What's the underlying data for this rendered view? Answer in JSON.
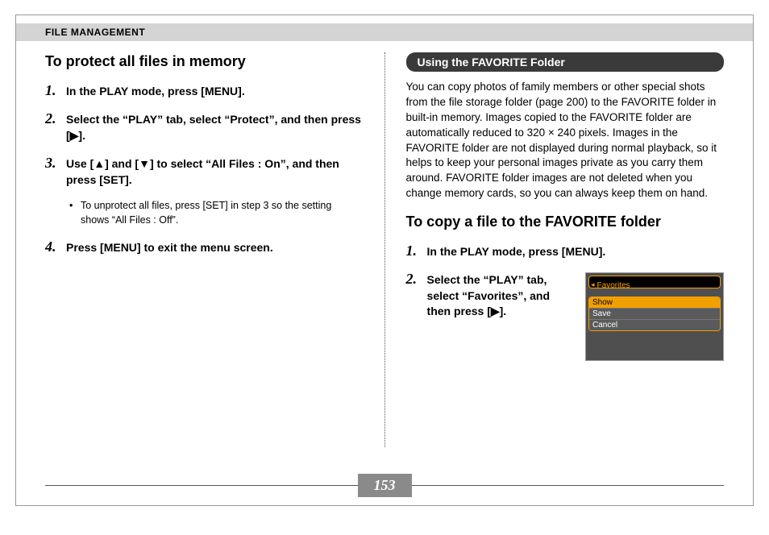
{
  "header": "FILE MANAGEMENT",
  "left": {
    "title": "To protect all files in memory",
    "steps": [
      "In the PLAY mode, press [MENU].",
      "Select the “PLAY” tab, select “Protect”, and then press [▶].",
      "Use [▲] and [▼] to select “All Files : On”, and then press [SET].",
      "Press [MENU] to exit the menu screen."
    ],
    "sub_bullet": "To unprotect all files, press [SET] in step 3 so the setting shows “All Files : Off”."
  },
  "right": {
    "pill": "Using the FAVORITE Folder",
    "para": "You can copy photos of family members or other special shots from the file storage folder (page 200) to the FAVORITE folder in built-in memory. Images copied to the FAVORITE folder are automatically reduced to 320 × 240 pixels. Images in the FAVORITE folder are not displayed during normal playback, so it helps to keep your personal images private as you carry them around. FAVORITE folder images are not deleted when you change memory cards, so you can always keep them on hand.",
    "title2": "To copy a file to the FAVORITE folder",
    "steps2": [
      "In the PLAY mode, press [MENU].",
      "Select the “PLAY” tab, select “Favorites”, and then press [▶]."
    ],
    "mock": {
      "header": "Favorites",
      "items": [
        "Show",
        "Save",
        "Cancel"
      ],
      "selected_index": 0
    }
  },
  "page_number": "153"
}
